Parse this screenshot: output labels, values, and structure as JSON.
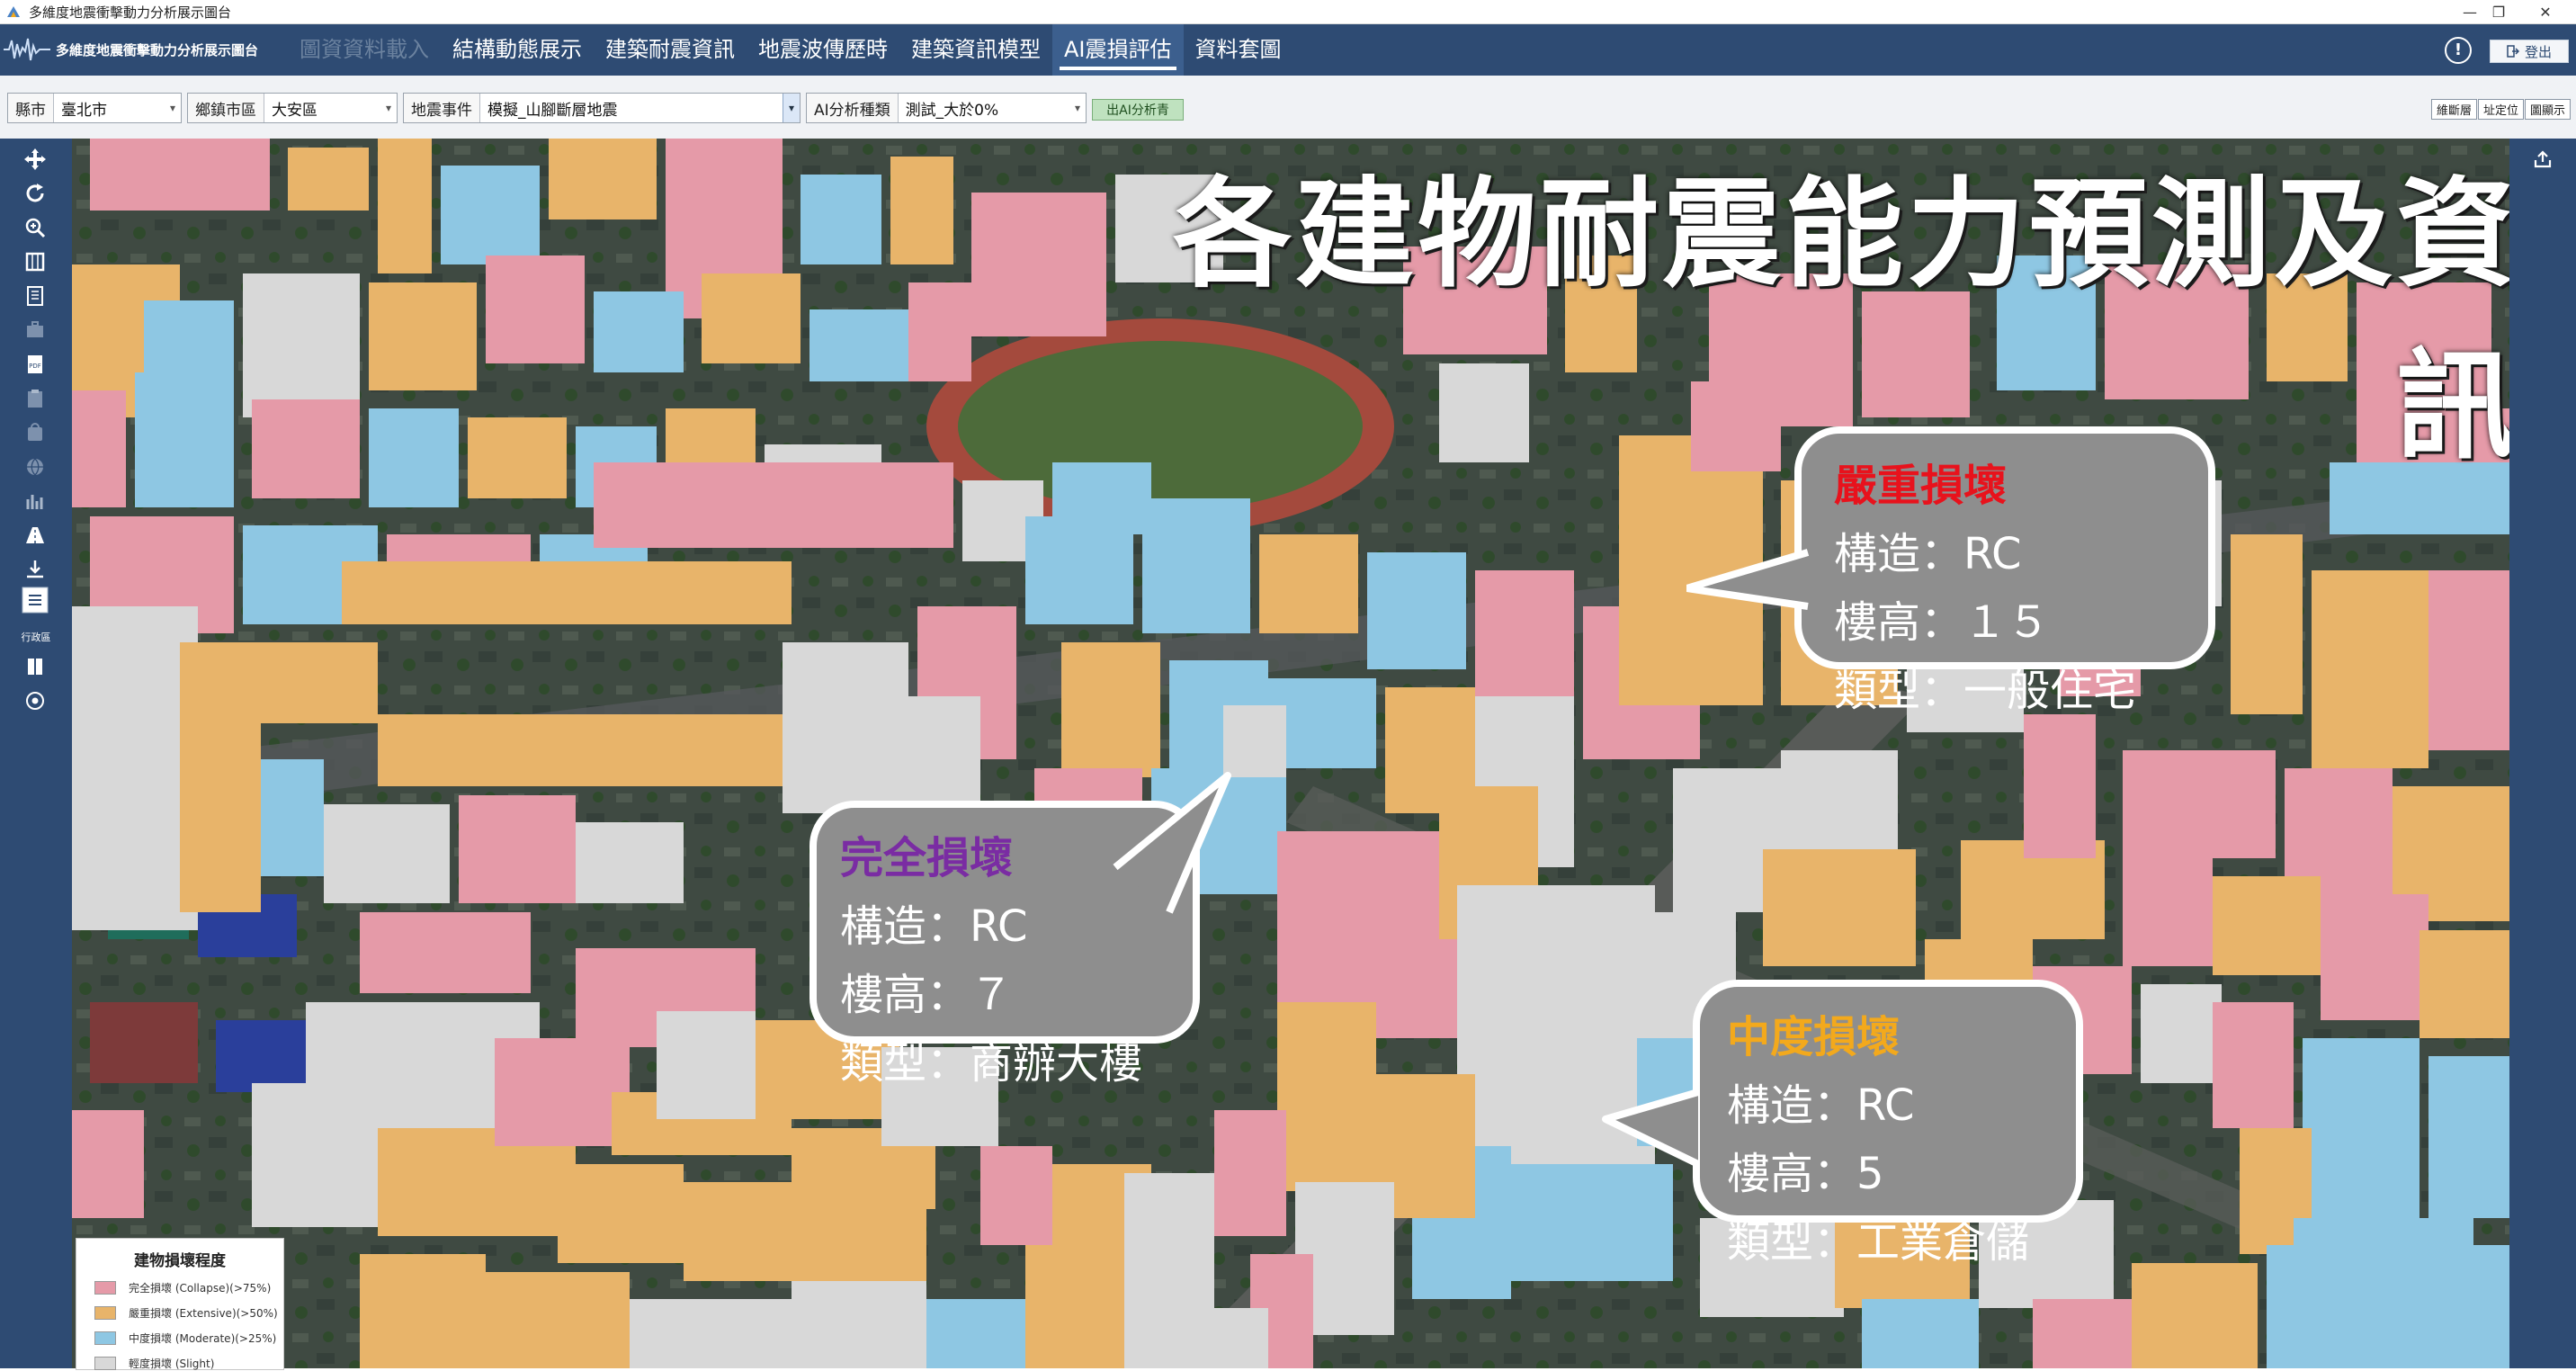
{
  "window": {
    "title": "多維度地震衝擊動力分析展示圖台",
    "controls": {
      "minimize": "—",
      "restore": "❐",
      "close": "✕"
    }
  },
  "app": {
    "brand": "多維度地震衝擊動力分析展示圖台",
    "menu": [
      {
        "label": "圖資資料載入",
        "state": "disabled"
      },
      {
        "label": "結構動態展示",
        "state": "normal"
      },
      {
        "label": "建築耐震資訊",
        "state": "normal"
      },
      {
        "label": "地震波傳歷時",
        "state": "normal"
      },
      {
        "label": "建築資訊模型",
        "state": "normal"
      },
      {
        "label": "AI震損評估",
        "state": "active"
      },
      {
        "label": "資料套圖",
        "state": "normal"
      }
    ],
    "help_icon": "!",
    "logout_label": "登出"
  },
  "filters": {
    "county": {
      "label": "縣市",
      "value": "臺北市"
    },
    "district": {
      "label": "鄉鎮市區",
      "value": "大安區"
    },
    "event": {
      "label": "地震事件",
      "value": "模擬_山腳斷層地震"
    },
    "analysis": {
      "label": "AI分析種類",
      "value": "測試_大於0%"
    },
    "run_button": "出AI分析青",
    "right_tools": [
      "維斷層",
      "址定位",
      "圖顯示"
    ]
  },
  "sidebar": {
    "label": "行政區"
  },
  "map": {
    "headline": "各建物耐震能力預測及資訊",
    "callouts": [
      {
        "title": "嚴重損壞",
        "color": "#e8121c",
        "structure": "構造：RC",
        "floors": "樓高：１５",
        "type": "類型：一般住宅"
      },
      {
        "title": "完全損壞",
        "color": "#7a2ca3",
        "structure": "構造：RC",
        "floors": "樓高：７",
        "type": "類型：商辦大樓"
      },
      {
        "title": "中度損壞",
        "color": "#f3a91c",
        "structure": "構造：RC",
        "floors": "樓高：5",
        "type": "類型：工業倉儲"
      }
    ]
  },
  "legend": {
    "title": "建物損壞程度",
    "items": [
      {
        "label": "完全損壞 (Collapse)(>75%)",
        "color": "#e59aa8"
      },
      {
        "label": "嚴重損壞 (Extensive)(>50%)",
        "color": "#e8b46a"
      },
      {
        "label": "中度損壞 (Moderate)(>25%)",
        "color": "#8ec7e3"
      },
      {
        "label": "輕度損壞 (Slight)",
        "color": "#d8d8d8"
      }
    ]
  },
  "colors": {
    "brand_bar": "#2e4b73",
    "collapse": "#e59aa8",
    "extensive": "#e8b46a",
    "moderate": "#8ec7e3",
    "slight": "#d8d8d8"
  }
}
